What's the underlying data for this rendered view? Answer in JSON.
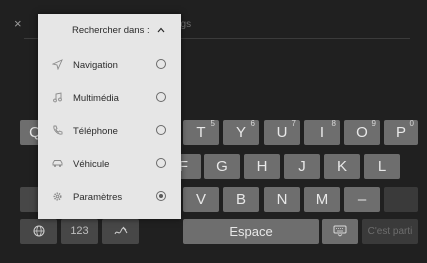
{
  "header": {
    "close_glyph": "×",
    "search_placeholder_fragment": "ngs"
  },
  "dropdown": {
    "title": "Rechercher dans :",
    "options": [
      {
        "label": "Navigation",
        "icon": "navigation-arrow-icon",
        "selected": false
      },
      {
        "label": "Multimédia",
        "icon": "music-note-icon",
        "selected": false
      },
      {
        "label": "Téléphone",
        "icon": "phone-icon",
        "selected": false
      },
      {
        "label": "Véhicule",
        "icon": "car-icon",
        "selected": false
      },
      {
        "label": "Paramètres",
        "icon": "gear-icon",
        "selected": true
      }
    ]
  },
  "keyboard": {
    "row1": [
      {
        "label": "Q",
        "sup": ""
      },
      {
        "label": "T",
        "sup": "5"
      },
      {
        "label": "Y",
        "sup": "6"
      },
      {
        "label": "U",
        "sup": "7"
      },
      {
        "label": "I",
        "sup": "8"
      },
      {
        "label": "O",
        "sup": "9"
      },
      {
        "label": "P",
        "sup": "0"
      }
    ],
    "row2": [
      "F",
      "G",
      "H",
      "J",
      "K",
      "L"
    ],
    "row3": [
      "V",
      "B",
      "N",
      "M",
      "–"
    ],
    "row4": {
      "numeric_label": "123",
      "space_label": "Espace",
      "ok_label": "C'est parti"
    }
  }
}
